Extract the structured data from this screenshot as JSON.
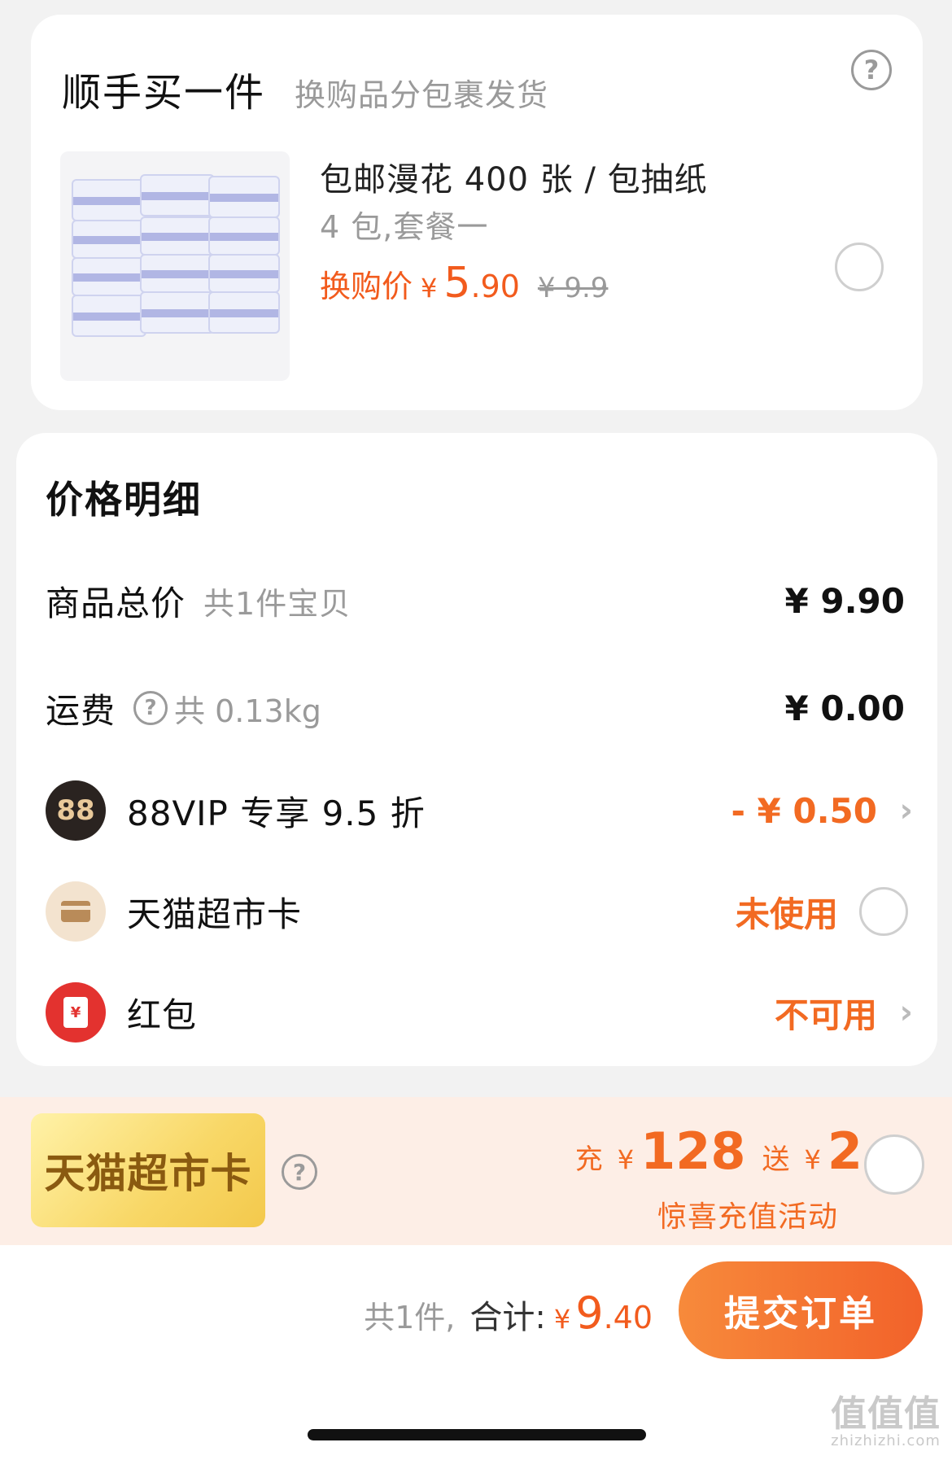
{
  "addon": {
    "title": "顺手买一件",
    "subtitle": "换购品分包裹发货",
    "help_icon": "question-circle-icon",
    "product": {
      "name": "包邮漫花 400 张 / 包抽纸",
      "variant": "4 包,套餐一",
      "price_label": "换购价",
      "currency": "¥",
      "price_int": "5",
      "price_dec": ".90",
      "original_price": "¥ 9.9",
      "selected": false
    }
  },
  "price_detail": {
    "title": "价格明细",
    "goods_total": {
      "label": "商品总价",
      "sub": "共1件宝贝",
      "value": "¥ 9.90"
    },
    "shipping": {
      "label": "运费",
      "sub": "共 0.13kg",
      "value": "¥ 0.00"
    },
    "vip": {
      "icon_text": "88",
      "label": "88VIP 专享 9.5 折",
      "value": "- ¥ 0.50"
    },
    "supermarket_card": {
      "label": "天猫超市卡",
      "value": "未使用",
      "selected": false
    },
    "red_packet": {
      "icon_text": "¥",
      "label": "红包",
      "value": "不可用"
    }
  },
  "recharge": {
    "badge": "天猫超市卡",
    "charge_label": "充",
    "currency": "¥",
    "charge_amount": "128",
    "gift_label": "送",
    "gift_amount": "2",
    "subtitle": "惊喜充值活动",
    "selected": false
  },
  "checkout": {
    "count": "共1件,",
    "total_label": "合计:",
    "currency": "¥",
    "total_int": "9",
    "total_dec": ".40",
    "submit_label": "提交订单"
  },
  "watermark": {
    "big": "值值值",
    "small": "zhizhizhi.com"
  },
  "colors": {
    "accent": "#f26a22",
    "price": "#f25b1d",
    "muted": "#9a9a9a",
    "background": "#f2f2f2"
  }
}
